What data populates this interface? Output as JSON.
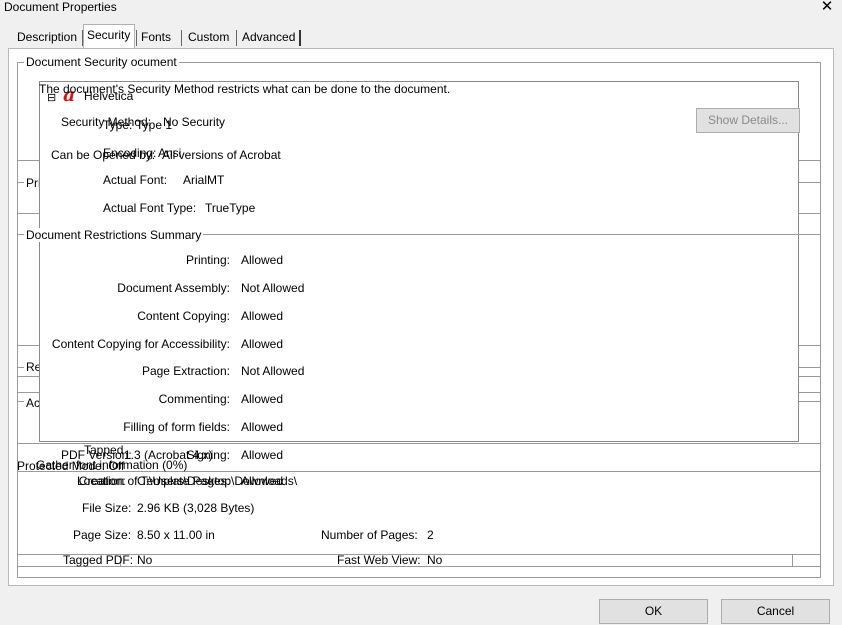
{
  "window": {
    "title": "Document Properties",
    "close_glyph": "✕"
  },
  "tabs": [
    {
      "label": "Description"
    },
    {
      "label": "Security"
    },
    {
      "label": "Fonts"
    },
    {
      "label": "Custom"
    },
    {
      "label": "Advanced"
    }
  ],
  "security": {
    "group_label": "Document Security ocument",
    "intro_text": "The document's Security Method restricts what can be done to the document.",
    "method_label": "Security Method:",
    "method_value": "No Security",
    "show_details_label": "Show Details...",
    "opened_by_label": "Can be Opened by:",
    "opened_by_value": "All versions of Acrobat",
    "partial_labels": {
      "pri": "Pri",
      "re": "Re",
      "ac": "Ac"
    }
  },
  "fonts_popup": {
    "expand_glyph": "⊟",
    "font_icon_glyph": "a",
    "font_name": "Helvetica",
    "type_label": "Type:",
    "type_value": "Type 1",
    "encoding_label": "Encoding:",
    "encoding_value": "Ansi",
    "actual_font_label": "Actual Font:",
    "actual_font_value": "ArialMT",
    "actual_font_type_label": "Actual Font Type:",
    "actual_font_type_value": "TrueType"
  },
  "restrictions": {
    "title": "Document Restrictions Summary",
    "rows": [
      {
        "label": "Printing:",
        "value": "Allowed"
      },
      {
        "label": "Document Assembly:",
        "value": "Not Allowed"
      },
      {
        "label": "Content Copying:",
        "value": "Allowed"
      },
      {
        "label": "Content Copying for Accessibility:",
        "value": "Allowed"
      },
      {
        "label": "Page Extraction:",
        "value": "Not Allowed"
      },
      {
        "label": "Commenting:",
        "value": "Allowed"
      },
      {
        "label": "Filling of form fields:",
        "value": "Allowed"
      },
      {
        "label": "Signing:",
        "value": "Allowed"
      },
      {
        "label": "Creation of Template Pages:",
        "value": "Allowed"
      }
    ]
  },
  "advanced": {
    "tapped": "Tapped",
    "pdf_version_label": "PDF Version:",
    "pdf_version_value": "1.3 (Acrobat 4.x)",
    "protected_mode": "Protected Mode: Off",
    "gather_text": "Gather font information (0%)",
    "location_label": "Location:",
    "location_value": "C:\\Users\\Desktop\\Downloads\\",
    "file_size_label": "File Size:",
    "file_size_value": "2.96 KB (3,028 Bytes)",
    "page_size_label": "Page Size:",
    "page_size_value": "8.50 x 11.00 in",
    "pages_label": "Number of Pages:",
    "pages_value": "2",
    "tagged_label": "Tagged PDF:",
    "tagged_value": "No",
    "fast_web_label": "Fast Web View:",
    "fast_web_value": "No"
  },
  "buttons": {
    "ok": "OK",
    "cancel": "Cancel"
  }
}
